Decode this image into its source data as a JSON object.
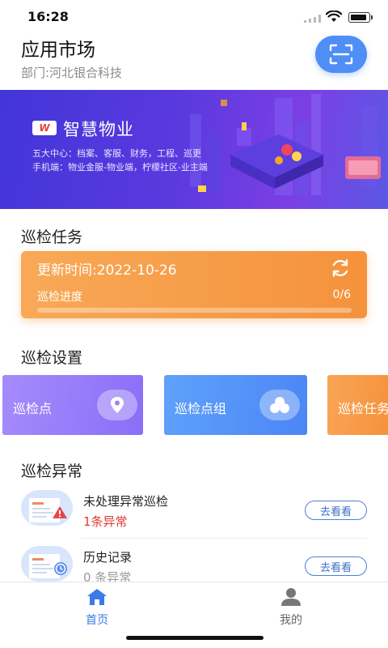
{
  "status_bar": {
    "time": "16:28"
  },
  "header": {
    "title": "应用市场",
    "department": "部门:河北银合科技",
    "scan_icon": "scan-icon"
  },
  "banner": {
    "logo_text": "W",
    "title": "智慧物业",
    "line1": "五大中心：档案、客服、财务，工程、巡更",
    "line2": "手机端：物业金服-物业端，柠檬社区-业主端"
  },
  "patrol_task": {
    "section_title": "巡检任务",
    "updated": "更新时间:2022-10-26",
    "progress_label": "巡检进度",
    "progress_text": "0/6",
    "progress_fraction": 0,
    "colors": {
      "card": "#f5923c"
    }
  },
  "patrol_settings": {
    "section_title": "巡检设置",
    "items": [
      {
        "label": "巡检点",
        "icon": "location-pin-icon",
        "color": "#8b6ef8"
      },
      {
        "label": "巡检点组",
        "icon": "group-circles-icon",
        "color": "#4b86f6"
      },
      {
        "label": "巡检任务",
        "icon": "task-icon",
        "color": "#f5913a"
      }
    ]
  },
  "patrol_abnormal": {
    "section_title": "巡检异常",
    "items": [
      {
        "name": "未处理异常巡检",
        "count": "1条异常",
        "count_color": "#e23a2e",
        "button": "去看看",
        "icon": "warning-document-icon"
      },
      {
        "name": "历史记录",
        "count": "0 条异常",
        "count_color": "#999999",
        "button": "去看看",
        "icon": "clock-document-icon"
      }
    ]
  },
  "tabbar": {
    "items": [
      {
        "label": "首页",
        "icon": "home-icon",
        "active": true
      },
      {
        "label": "我的",
        "icon": "user-icon",
        "active": false
      }
    ],
    "active_color": "#3b7ae8",
    "inactive_color": "#666666"
  }
}
